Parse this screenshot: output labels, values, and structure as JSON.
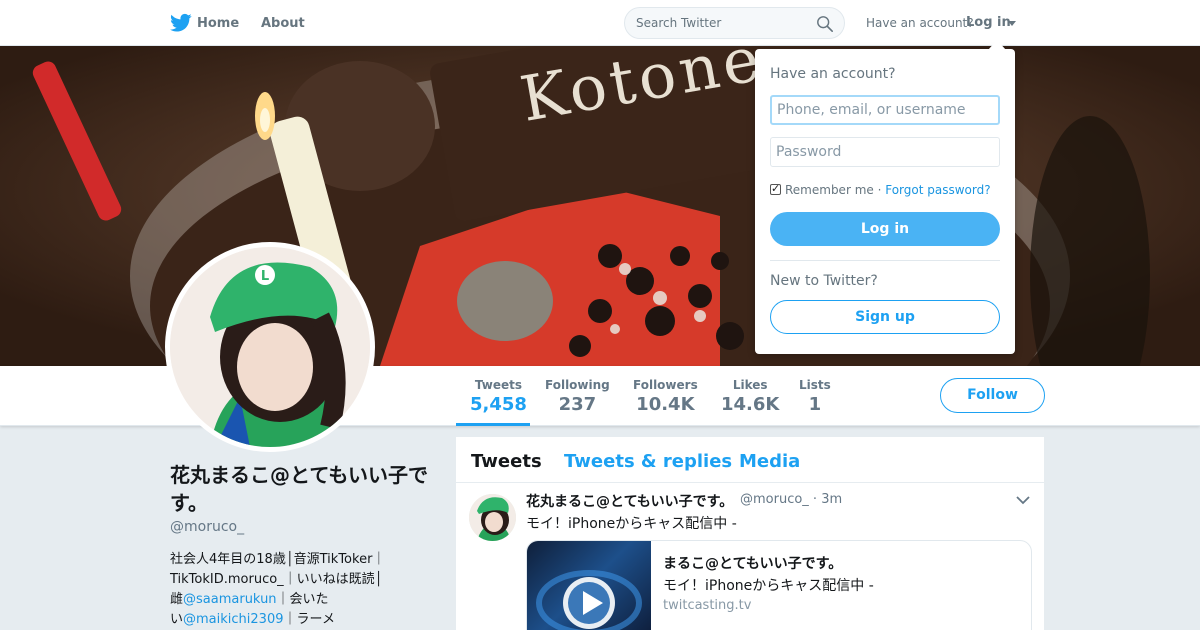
{
  "topbar": {
    "logo_icon": "twitter-bird-icon",
    "home_label": "Home",
    "about_label": "About",
    "search_placeholder": "Search Twitter",
    "have_account_text": "Have an account?",
    "login_label": "Log in"
  },
  "profile": {
    "name": "花丸まるこ@とてもいい子です。",
    "handle": "@moruco_",
    "bio": {
      "line1": "社会人4年目の18歳│音源TikToker｜",
      "line2": "TikTokID.moruco_｜いいねは既読│",
      "line3_prefix": "雌",
      "mention1": "@saamarukun",
      "line3_suffix": "｜会いた",
      "line4_prefix": "い",
      "mention2": "@maikichi2309",
      "line4_suffix": "｜ラーメ"
    },
    "follow_label": "Follow"
  },
  "stats": [
    {
      "label": "Tweets",
      "value": "5,458"
    },
    {
      "label": "Following",
      "value": "237"
    },
    {
      "label": "Followers",
      "value": "10.4K"
    },
    {
      "label": "Likes",
      "value": "14.6K"
    },
    {
      "label": "Lists",
      "value": "1"
    }
  ],
  "timeline": {
    "tabs": [
      "Tweets",
      "Tweets & replies",
      "Media"
    ],
    "tweet": {
      "author": "花丸まるこ@とてもいい子です。",
      "meta": "@moruco_ · 3m",
      "text": "モイ！iPhoneからキャス配信中 -",
      "card": {
        "title": "まるこ@とてもいい子です。",
        "description": "モイ！iPhoneからキャス配信中 -",
        "url": "twitcasting.tv"
      }
    }
  },
  "login_dropdown": {
    "heading": "Have an account?",
    "username_placeholder": "Phone, email, or username",
    "password_placeholder": "Password",
    "remember_label": "Remember me",
    "separator": " · ",
    "forgot_label": "Forgot password?",
    "login_button": "Log in",
    "new_text": "New to Twitter?",
    "signup_button": "Sign up"
  },
  "banner_text": "Kotone",
  "colors": {
    "accent": "#1da1f2",
    "login_button": "#4ab3f4",
    "background": "#e6ecf0"
  }
}
